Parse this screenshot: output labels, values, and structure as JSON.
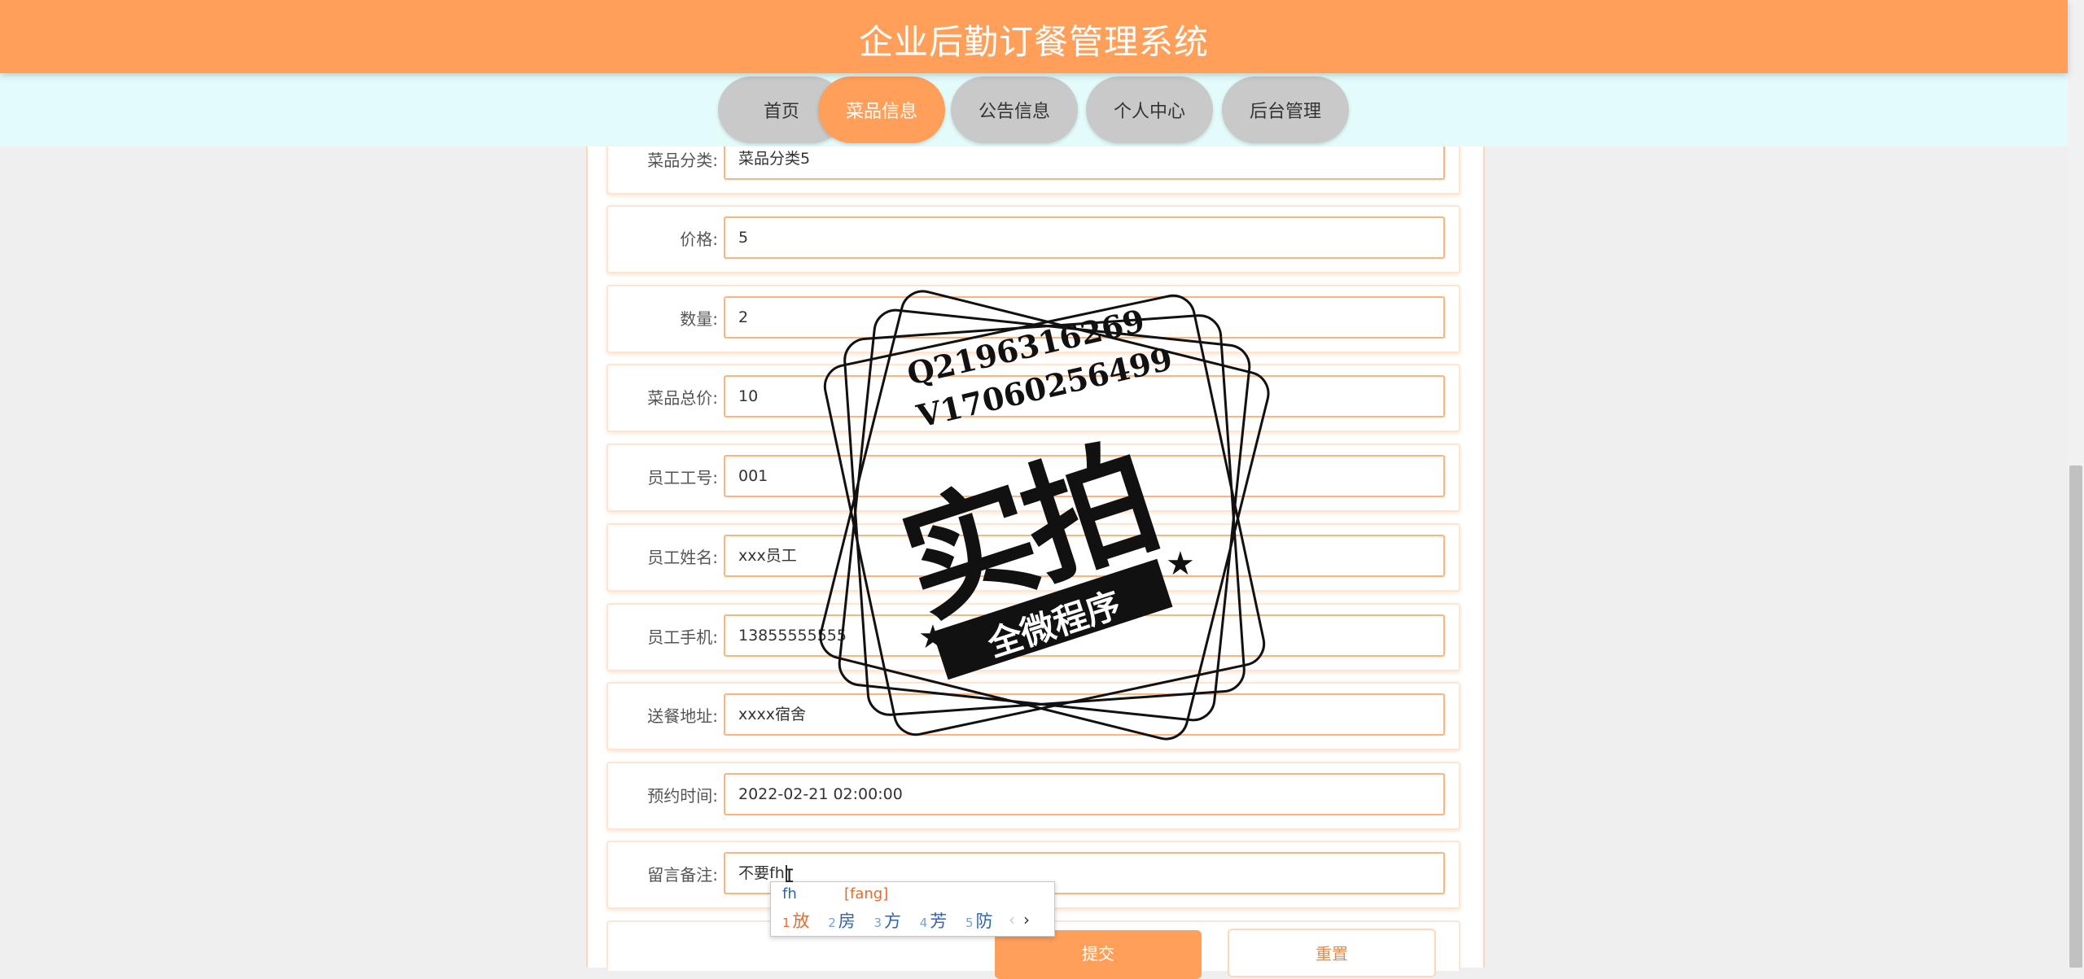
{
  "header": {
    "title": "企业后勤订餐管理系统"
  },
  "nav": [
    {
      "label": "首页",
      "active": false
    },
    {
      "label": "菜品信息",
      "active": true
    },
    {
      "label": "公告信息",
      "active": false
    },
    {
      "label": "个人中心",
      "active": false
    },
    {
      "label": "后台管理",
      "active": false
    }
  ],
  "form": {
    "fields": [
      {
        "label": "菜品分类:",
        "value": "菜品分类5"
      },
      {
        "label": "价格:",
        "value": "5"
      },
      {
        "label": "数量:",
        "value": "2"
      },
      {
        "label": "菜品总价:",
        "value": "10"
      },
      {
        "label": "员工工号:",
        "value": "001"
      },
      {
        "label": "员工姓名:",
        "value": "xxx员工"
      },
      {
        "label": "员工手机:",
        "value": "13855555555"
      },
      {
        "label": "送餐地址:",
        "value": "xxxx宿舍"
      },
      {
        "label": "预约时间:",
        "value": "2022-02-21 02:00:00"
      },
      {
        "label": "留言备注:",
        "value": "不要fh"
      }
    ],
    "submit_label": "提交",
    "reset_label": "重置"
  },
  "ime": {
    "typed": "fh",
    "pinyin": "[fang]",
    "candidates": [
      {
        "n": "1",
        "text": "放"
      },
      {
        "n": "2",
        "text": "房"
      },
      {
        "n": "3",
        "text": "方"
      },
      {
        "n": "4",
        "text": "芳"
      },
      {
        "n": "5",
        "text": "防"
      }
    ],
    "prev": "‹",
    "next": "›"
  },
  "watermark": {
    "line1": "Q2196316269",
    "line2": "V17060256499",
    "big": "实拍",
    "ribbon": "全微程序"
  },
  "colors": {
    "accent": "#ff9f5a",
    "nav_bg": "#e3fcfb",
    "nav_inactive": "#c9c9c9"
  }
}
